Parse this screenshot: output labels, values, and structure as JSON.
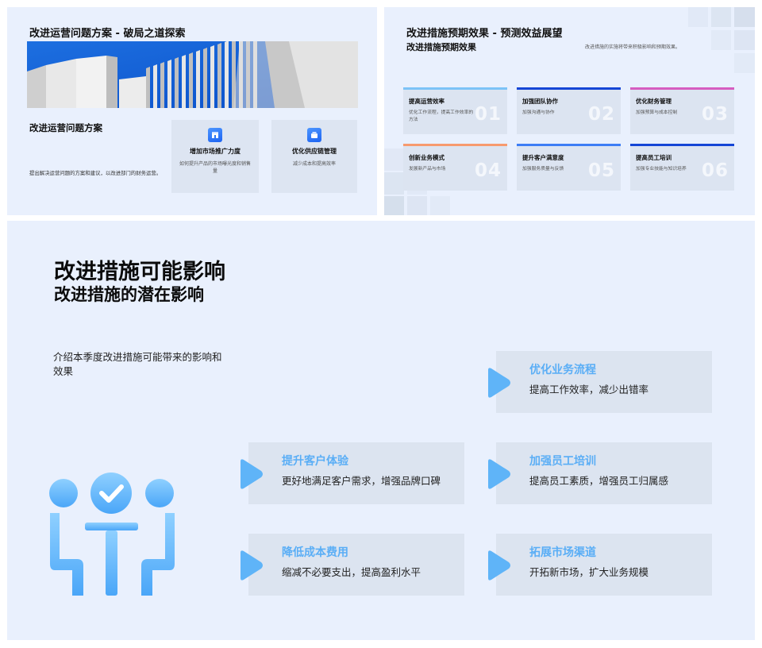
{
  "slide1": {
    "title": "改进运营问题方案 - 破局之道探索",
    "subtitle": "改进运营问题方案",
    "description": "提出解决运营问题的方案和建议，以改进部门的财务运营。",
    "cards": [
      {
        "icon": "store-icon",
        "title": "增加市场推广力度",
        "text": "如何提升产品的市场曝光度和销售量"
      },
      {
        "icon": "box-icon",
        "title": "优化供应链管理",
        "text": "减少成本和提高效率"
      }
    ]
  },
  "slide2": {
    "title": "改进措施预期效果 - 预测效益展望",
    "subtitle": "改进措施预期效果",
    "description": "改进措施的实施将带来积极影响和预期效果。",
    "cards": [
      {
        "title": "提高运营效率",
        "text": "优化工作流程，提高工作效率的方法",
        "number": "01",
        "color": "#7cc3f7"
      },
      {
        "title": "加强团队协作",
        "text": "加强沟通与协作",
        "number": "02",
        "color": "#1546d6"
      },
      {
        "title": "优化财务管理",
        "text": "加强预算与成本控制",
        "number": "03",
        "color": "#d65cc0"
      },
      {
        "title": "创新业务模式",
        "text": "发展新产品与市场",
        "number": "04",
        "color": "#f79a6e"
      },
      {
        "title": "提升客户满意度",
        "text": "加强服务质量与反馈",
        "number": "05",
        "color": "#3d7df5"
      },
      {
        "title": "提高员工培训",
        "text": "加强专业技能与知识培养",
        "number": "06",
        "color": "#1546d6"
      }
    ]
  },
  "slide3": {
    "heading": "改进措施可能影响",
    "subheading": "改进措施的潜在影响",
    "intro": "介绍本季度改进措施可能带来的影响和效果",
    "art_icon": "meeting-check-icon",
    "items": [
      {
        "title": "优化业务流程",
        "text": "提高工作效率，减少出错率"
      },
      {
        "title": "提升客户体验",
        "text": "更好地满足客户需求，增强品牌口碑"
      },
      {
        "title": "加强员工培训",
        "text": "提高员工素质，增强员工归属感"
      },
      {
        "title": "降低成本费用",
        "text": "缩减不必要支出，提高盈利水平"
      },
      {
        "title": "拓展市场渠道",
        "text": "开拓新市场，扩大业务规模"
      }
    ]
  }
}
